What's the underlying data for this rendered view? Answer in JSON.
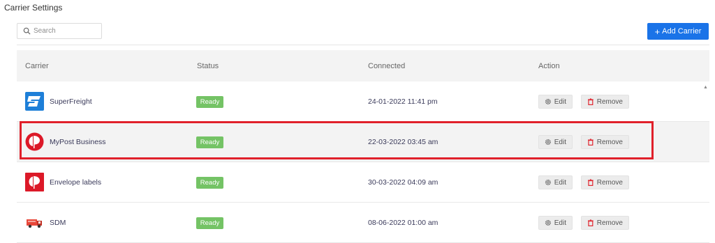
{
  "page": {
    "title": "Carrier Settings"
  },
  "toolbar": {
    "search_placeholder": "Search",
    "search_value": "",
    "add_label": "Add Carrier",
    "add_icon": "plus-icon",
    "accent_color": "#1a73e8"
  },
  "table": {
    "columns": [
      "Carrier",
      "Status",
      "Connected",
      "Action"
    ],
    "rows": [
      {
        "carrier": "SuperFreight",
        "logo": "superfreight-logo",
        "status": "Ready",
        "connected": "24-01-2022 11:41 pm",
        "edit": "Edit",
        "remove": "Remove"
      },
      {
        "carrier": "MyPost Business",
        "logo": "auspost-logo",
        "status": "Ready",
        "connected": "22-03-2022 03:45 am",
        "edit": "Edit",
        "remove": "Remove",
        "highlighted": true
      },
      {
        "carrier": "Envelope labels",
        "logo": "auspost-square-logo",
        "status": "Ready",
        "connected": "30-03-2022 04:09 am",
        "edit": "Edit",
        "remove": "Remove"
      },
      {
        "carrier": "SDM",
        "logo": "truck-logo",
        "status": "Ready",
        "connected": "08-06-2022 01:00 am",
        "edit": "Edit",
        "remove": "Remove"
      }
    ]
  },
  "colors": {
    "status_ready": "#74c365",
    "remove_icon": "#e0202a",
    "highlight_border": "#e0202a"
  }
}
